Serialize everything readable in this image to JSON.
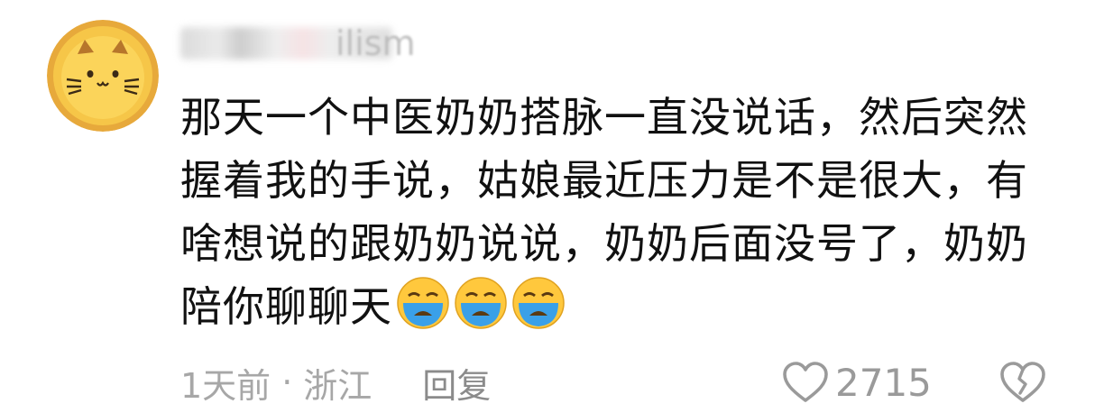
{
  "comment": {
    "username": "ilism",
    "text": "那天一个中医奶奶搭脉一直没说话，然后突然握着我的手说，姑娘最近压力是不是很大，有啥想说的跟奶奶说说，奶奶后面没号了，奶奶陪你聊聊天",
    "emojis": [
      "crying-face-emoji",
      "crying-face-emoji",
      "crying-face-emoji"
    ],
    "time": "1天前",
    "separator": "·",
    "location": "浙江",
    "reply_label": "回复",
    "like_count": "2715"
  },
  "icons": {
    "like": "heart-outline-icon",
    "dislike": "broken-heart-outline-icon"
  },
  "colors": {
    "text": "#111111",
    "meta": "#a7a7a7",
    "emoji_face": "#ffc83d",
    "emoji_tears": "#3aa0e8",
    "avatar_tart": "#f4c13a"
  }
}
